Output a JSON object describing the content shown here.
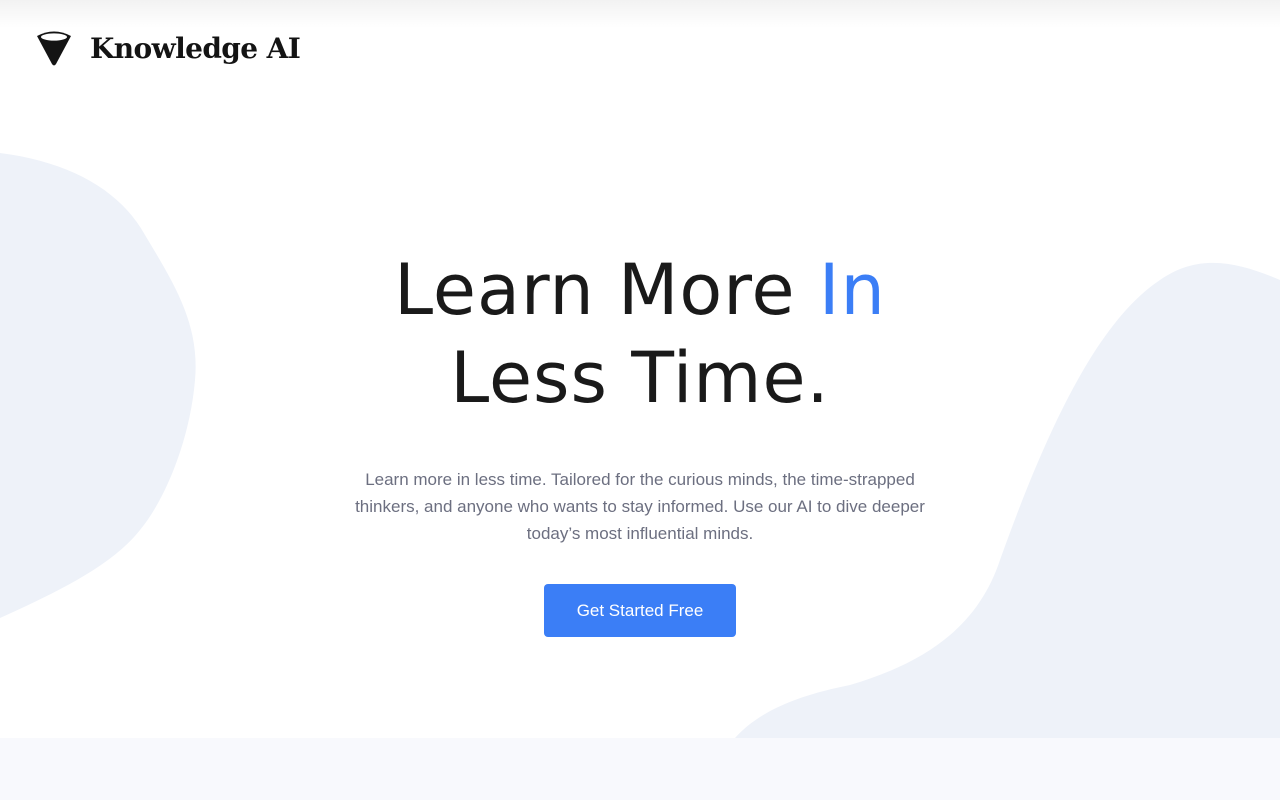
{
  "header": {
    "brand": "Knowledge AI",
    "logo_icon": "inverted-cone-logo-icon"
  },
  "hero": {
    "headline_line1": "Learn More ",
    "headline_accent": "In",
    "headline_line2": "Less Time.",
    "subtext": "Learn more in less time. Tailored for the curious minds, the time-strapped thinkers, and anyone who wants to stay informed. Use our AI to dive deeper today’s most influential minds.",
    "cta_label": "Get Started Free"
  },
  "colors": {
    "accent": "#3b7ef6",
    "text_dark": "#1a1a1a",
    "text_muted": "#6c6f80",
    "blob": "#eef2f9",
    "band": "#f8f9fd"
  }
}
